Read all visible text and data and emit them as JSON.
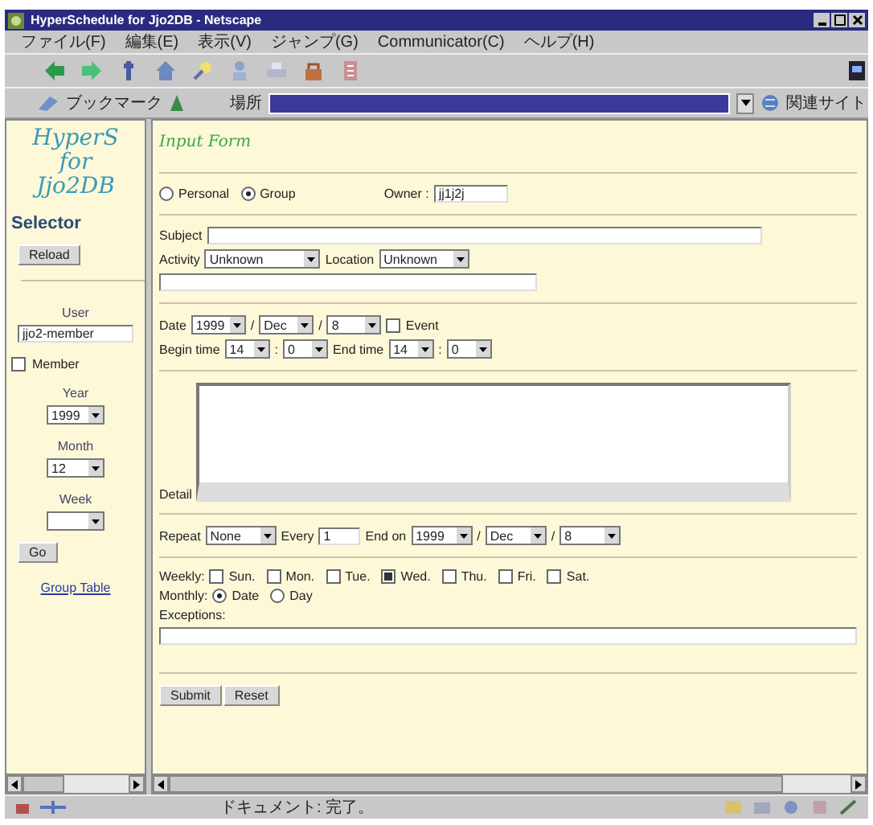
{
  "window": {
    "title": "HyperSchedule for Jjo2DB - Netscape"
  },
  "menu": [
    "ファイル(F)",
    "編集(E)",
    "表示(V)",
    "ジャンプ(G)",
    "Communicator(C)",
    "ヘルプ(H)"
  ],
  "location_bar": {
    "bookmarks": "ブックマーク",
    "location_label": "場所",
    "related": "関連サイト"
  },
  "sidebar": {
    "title_lines": [
      "HyperS",
      "for",
      "Jjo2DB"
    ],
    "heading": "Selector",
    "reload": "Reload",
    "user_label": "User",
    "user_value": "jjo2-member",
    "member": {
      "label": "Member",
      "checked": false
    },
    "year_label": "Year",
    "year": "1999",
    "month_label": "Month",
    "month": "12",
    "week_label": "Week",
    "go": "Go",
    "link": "Group Table"
  },
  "form": {
    "title": "Input Form",
    "scope": [
      {
        "label": "Personal",
        "selected": false
      },
      {
        "label": "Group",
        "selected": true
      }
    ],
    "owner_label": "Owner :",
    "owner": "jj1j2j",
    "subject_label": "Subject",
    "activity_label": "Activity",
    "activity": "Unknown",
    "location_label": "Location",
    "location": "Unknown",
    "date_label": "Date",
    "date": [
      "1999",
      "Dec",
      "8"
    ],
    "separators": [
      "/",
      "/"
    ],
    "event": {
      "label": "Event",
      "checked": false
    },
    "begin_label": "Begin time",
    "begin": [
      "14",
      "0"
    ],
    "end_label": "End time",
    "end": [
      "14",
      "0"
    ],
    "time_separator": ":",
    "detail_label": "Detail",
    "repeat_label": "Repeat",
    "repeat": "None",
    "every_label": "Every",
    "every": "1",
    "end_on_label": "End on",
    "end_on": [
      "1999",
      "Dec",
      "8"
    ],
    "weekly_label": "Weekly:",
    "weekdays": [
      {
        "label": "Sun.",
        "checked": false
      },
      {
        "label": "Mon.",
        "checked": false
      },
      {
        "label": "Tue.",
        "checked": false
      },
      {
        "label": "Wed.",
        "checked": true
      },
      {
        "label": "Thu.",
        "checked": false
      },
      {
        "label": "Fri.",
        "checked": false
      },
      {
        "label": "Sat.",
        "checked": false
      }
    ],
    "monthly_label": "Monthly:",
    "monthly": [
      {
        "label": "Date",
        "selected": true
      },
      {
        "label": "Day",
        "selected": false
      }
    ],
    "exceptions_label": "Exceptions:",
    "buttons": [
      "Submit",
      "Reset"
    ]
  },
  "status_bar": {
    "text": "ドキュメント: 完了。"
  }
}
